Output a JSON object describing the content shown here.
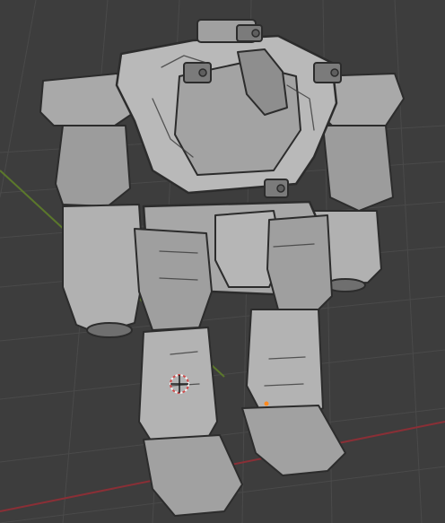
{
  "viewport": {
    "background": "#3d3d3d",
    "grid_color": "#4a4a4a",
    "axis_x_color": "#8a2f36",
    "axis_y_color": "#5f7f2a"
  },
  "model": {
    "shade_light": "#b9b9b9",
    "shade_mid": "#9c9c9c",
    "shade_dark": "#6f6f6f",
    "edge": "#2c2c2c"
  },
  "icons": {
    "origin": "3d-cursor-icon",
    "sensors": "sensor-pod-icon"
  }
}
